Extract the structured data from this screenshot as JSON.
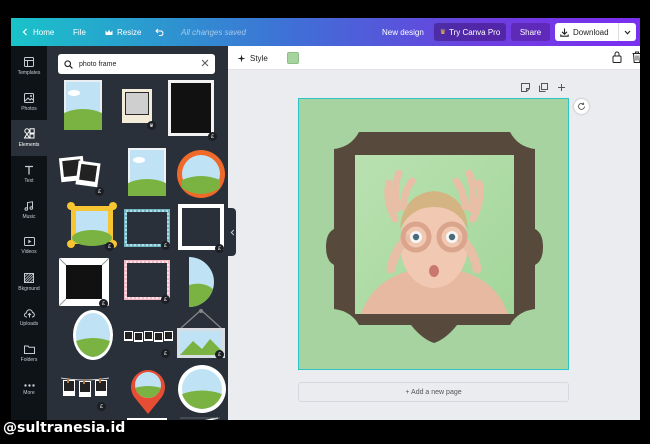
{
  "topbar": {
    "home": "Home",
    "file": "File",
    "resize": "Resize",
    "save_status": "All changes saved",
    "new_design": "New design",
    "try_pro": "Try Canva Pro",
    "share": "Share",
    "download": "Download"
  },
  "rail": {
    "items": [
      {
        "label": "Templates",
        "icon": "templates-icon"
      },
      {
        "label": "Photos",
        "icon": "photos-icon"
      },
      {
        "label": "Elements",
        "icon": "elements-icon",
        "active": true
      },
      {
        "label": "Text",
        "icon": "text-icon"
      },
      {
        "label": "Music",
        "icon": "music-icon"
      },
      {
        "label": "Videos",
        "icon": "videos-icon"
      },
      {
        "label": "Bkground",
        "icon": "background-icon"
      },
      {
        "label": "Uploads",
        "icon": "uploads-icon"
      },
      {
        "label": "Folders",
        "icon": "folders-icon"
      },
      {
        "label": "More",
        "icon": "more-icon"
      }
    ]
  },
  "search": {
    "value": "photo frame"
  },
  "results": {
    "pro_badge_glyph": "£",
    "crown_glyph": "♛"
  },
  "editor": {
    "style_label": "Style",
    "style_color": "#a6d3a0",
    "add_page": "+ Add a new page"
  },
  "colors": {
    "page_background": "#a6d3a0",
    "frame_color": "#574a3c",
    "panel_background": "#293039",
    "rail_background": "#0e1318",
    "selection": "#2bc4c8"
  },
  "watermark": "@sultranesia.id"
}
